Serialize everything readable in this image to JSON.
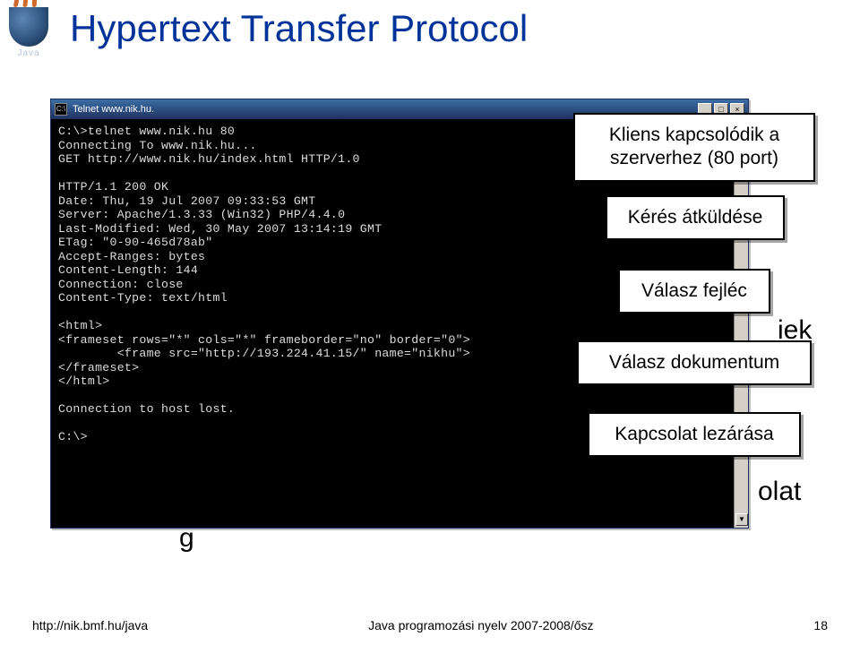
{
  "logo_text": "Java",
  "title": "Hypertext Transfer Protocol",
  "telnet": {
    "window_title": "Telnet www.nik.hu.",
    "cmd_icon_text": "C:\\",
    "min_label": "_",
    "max_label": "□",
    "close_label": "×",
    "scroll_up": "▲",
    "scroll_down": "▼",
    "lines": "C:\\>telnet www.nik.hu 80\nConnecting To www.nik.hu...\nGET http://www.nik.hu/index.html HTTP/1.0\n\nHTTP/1.1 200 OK\nDate: Thu, 19 Jul 2007 09:33:53 GMT\nServer: Apache/1.3.33 (Win32) PHP/4.4.0\nLast-Modified: Wed, 30 May 2007 13:14:19 GMT\nETag: \"0-90-465d78ab\"\nAccept-Ranges: bytes\nContent-Length: 144\nConnection: close\nContent-Type: text/html\n\n<html>\n<frameset rows=\"*\" cols=\"*\" frameborder=\"no\" border=\"0\">\n        <frame src=\"http://193.224.41.15/\" name=\"nikhu\">\n</frameset>\n</html>\n\nConnection to host lost.\n\nC:\\>"
  },
  "callouts": {
    "c1": "Kliens kapcsolódik a szerverhez (80 port)",
    "c2": "Kérés átküldése",
    "c3": "Válasz fejléc",
    "c4": "Válasz dokumentum",
    "c5": "Kapcsolat lezárása"
  },
  "behind": {
    "b1": "iek",
    "b2": "olat",
    "b3": "g"
  },
  "footer": {
    "url": "http://nik.bmf.hu/java",
    "center": "Java programozási nyelv 2007-2008/ősz",
    "page": "18"
  }
}
